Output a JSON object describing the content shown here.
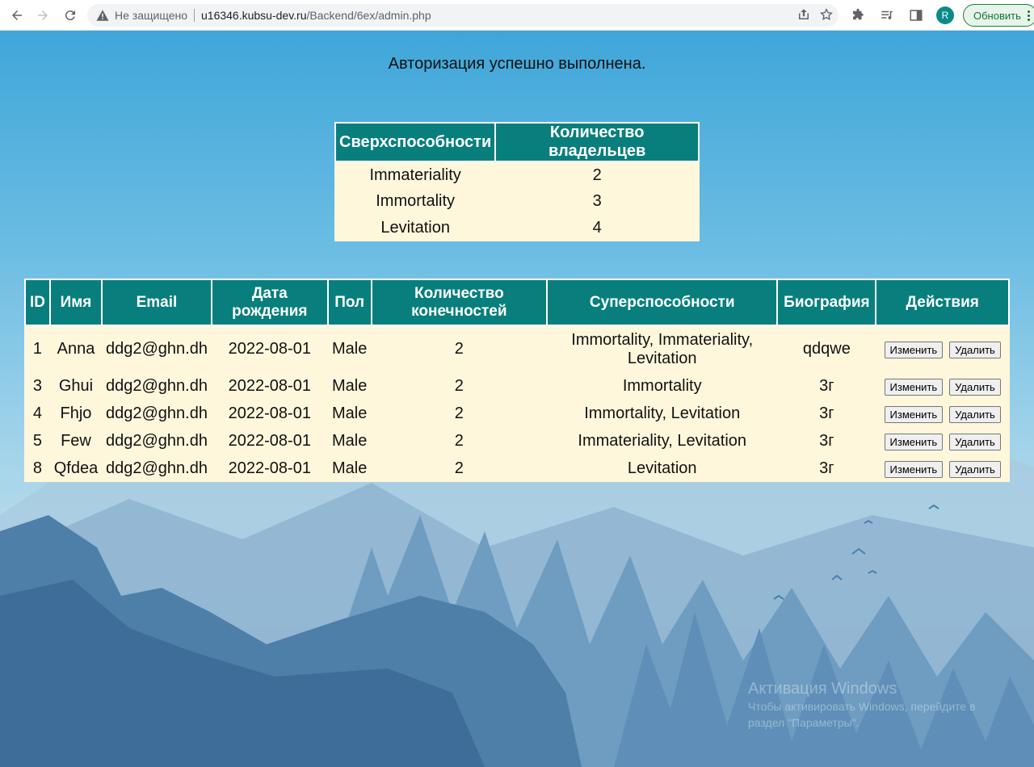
{
  "browser": {
    "insecure_label": "Не защищено",
    "url_host": "u16346.kubsu-dev.ru",
    "url_path": "/Backend/6ex/admin.php",
    "avatar_letter": "R",
    "update_label": "Обновить"
  },
  "page": {
    "message": "Авторизация успешно выполнена."
  },
  "powers_table": {
    "headers": [
      "Сверхспособности",
      "Количество владельцев"
    ],
    "rows": [
      [
        "Immateriality",
        "2"
      ],
      [
        "Immortality",
        "3"
      ],
      [
        "Levitation",
        "4"
      ]
    ]
  },
  "users_table": {
    "headers": [
      "ID",
      "Имя",
      "Email",
      "Дата рождения",
      "Пол",
      "Количество конечностей",
      "Суперспособности",
      "Биография",
      "Действия"
    ],
    "edit_label": "Изменить",
    "delete_label": "Удалить",
    "rows": [
      [
        "1",
        "Anna",
        "ddg2@ghn.dh",
        "2022-08-01",
        "Male",
        "2",
        "Immortality, Immateriality, Levitation",
        "qdqwe"
      ],
      [
        "3",
        "Ghui",
        "ddg2@ghn.dh",
        "2022-08-01",
        "Male",
        "2",
        "Immortality",
        "3г"
      ],
      [
        "4",
        "Fhjo",
        "ddg2@ghn.dh",
        "2022-08-01",
        "Male",
        "2",
        "Immortality, Levitation",
        "3г"
      ],
      [
        "5",
        "Few",
        "ddg2@ghn.dh",
        "2022-08-01",
        "Male",
        "2",
        "Immateriality, Levitation",
        "3г"
      ],
      [
        "8",
        "Qfdea",
        "ddg2@ghn.dh",
        "2022-08-01",
        "Male",
        "2",
        "Levitation",
        "3г"
      ]
    ]
  },
  "watermark": {
    "title": "Активация Windows",
    "line1": "Чтобы активировать Windows, перейдите в",
    "line2": "раздел \"Параметры\"."
  },
  "colors": {
    "header_bg": "#087f7d",
    "table_bg": "#fff7dc",
    "update_accent": "#188038"
  }
}
